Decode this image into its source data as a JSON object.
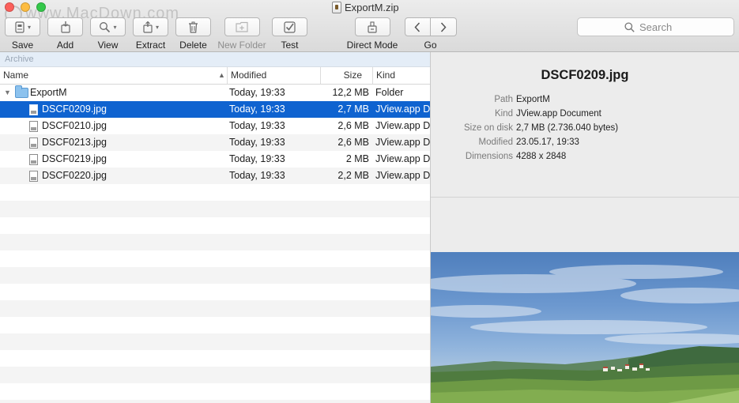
{
  "window": {
    "title": "ExportM.zip",
    "watermark": "www.MacDown.com"
  },
  "toolbar": {
    "save": "Save",
    "add": "Add",
    "view": "View",
    "extract": "Extract",
    "delete": "Delete",
    "new_folder": "New Folder",
    "test": "Test",
    "direct_mode": "Direct Mode",
    "go": "Go"
  },
  "search": {
    "placeholder": "Search"
  },
  "browser": {
    "archive_label": "Archive",
    "columns": {
      "name": "Name",
      "modified": "Modified",
      "size": "Size",
      "kind": "Kind"
    },
    "rows": [
      {
        "name": "ExportM",
        "modified": "Today, 19:33",
        "size": "12,2 MB",
        "kind": "Folder",
        "type": "folder"
      },
      {
        "name": "DSCF0209.jpg",
        "modified": "Today, 19:33",
        "size": "2,7 MB",
        "kind": "JView.app Document",
        "type": "file",
        "selected": true
      },
      {
        "name": "DSCF0210.jpg",
        "modified": "Today, 19:33",
        "size": "2,6 MB",
        "kind": "JView.app Document",
        "type": "file"
      },
      {
        "name": "DSCF0213.jpg",
        "modified": "Today, 19:33",
        "size": "2,6 MB",
        "kind": "JView.app Document",
        "type": "file"
      },
      {
        "name": "DSCF0219.jpg",
        "modified": "Today, 19:33",
        "size": "2 MB",
        "kind": "JView.app Document",
        "type": "file"
      },
      {
        "name": "DSCF0220.jpg",
        "modified": "Today, 19:33",
        "size": "2,2 MB",
        "kind": "JView.app Document",
        "type": "file"
      }
    ]
  },
  "inspector": {
    "title": "DSCF0209.jpg",
    "labels": {
      "path": "Path",
      "kind": "Kind",
      "size": "Size on disk",
      "modified": "Modified",
      "dimensions": "Dimensions"
    },
    "values": {
      "path": "ExportM",
      "kind": "JView.app Document",
      "size": "2,7 MB (2.736.040 bytes)",
      "modified": "23.05.17, 19:33",
      "dimensions": "4288 x 2848"
    }
  },
  "colors": {
    "selection": "#0f63d0",
    "archive_bar": "#e4edf7",
    "inspector_bg": "#ececec"
  }
}
